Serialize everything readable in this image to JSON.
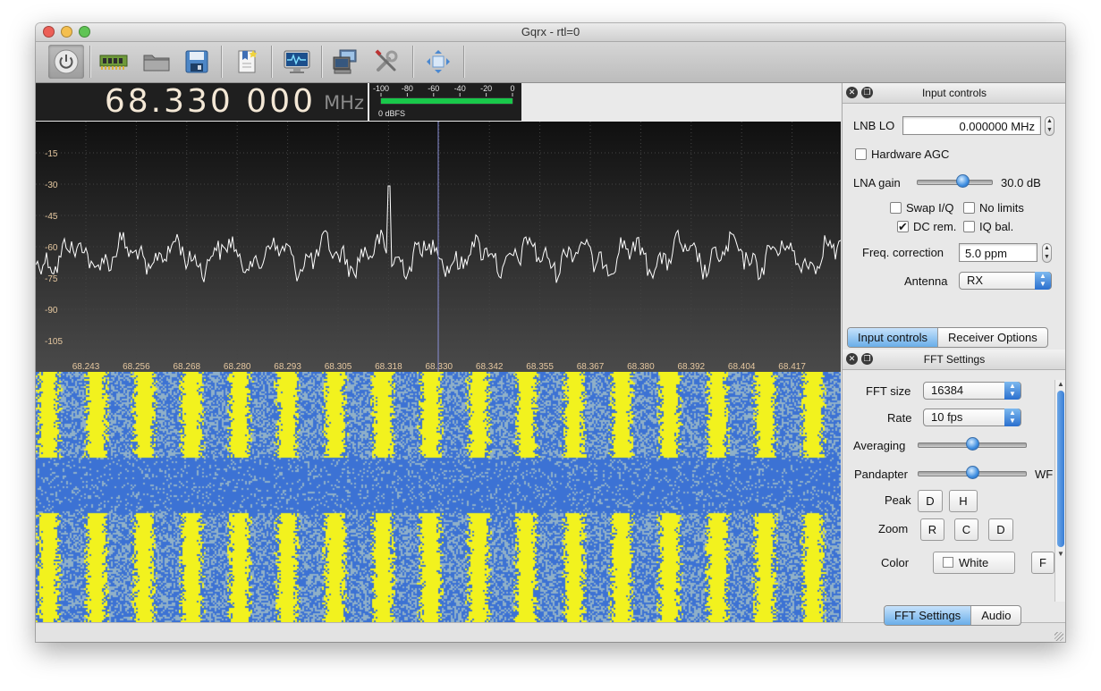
{
  "window": {
    "title": "Gqrx  - rtl=0"
  },
  "traffic_lights": {
    "close": "#ec5f57",
    "minimize": "#f4bf4f",
    "zoom": "#5fc454"
  },
  "toolbar": {
    "buttons": [
      {
        "name": "power-icon",
        "tip": "Start/Stop"
      },
      {
        "name": "device-icon"
      },
      {
        "name": "folder-icon"
      },
      {
        "name": "save-icon"
      },
      {
        "name": "bookmark-icon"
      },
      {
        "name": "monitor-icon"
      },
      {
        "name": "network-icon"
      },
      {
        "name": "tools-icon"
      },
      {
        "name": "fullscreen-icon"
      }
    ]
  },
  "frequency": {
    "value": "68.330 000",
    "unit": "MHz"
  },
  "meter": {
    "scale": [
      "-100",
      "-80",
      "-60",
      "-40",
      "-20",
      "0"
    ],
    "label": "0 dBFS",
    "level": 1.0,
    "bar_color": "#19c84a"
  },
  "plot": {
    "y_ticks": [
      "-15",
      "-30",
      "-45",
      "-60",
      "-75",
      "-90",
      "-105"
    ],
    "x_ticks": [
      "68.243",
      "68.256",
      "68.268",
      "68.280",
      "68.293",
      "68.305",
      "68.318",
      "68.330",
      "68.342",
      "68.355",
      "68.367",
      "68.380",
      "68.392",
      "68.404",
      "68.417"
    ],
    "trace_color": "#ffffff",
    "center_marker_color": "#8a8fd6"
  },
  "waterfall": {
    "colors": {
      "low": "#3c72d4",
      "mid": "#8fb0c8",
      "high": "#f2f21e"
    }
  },
  "input_controls": {
    "title": "Input controls",
    "lnb_lo_label": "LNB LO",
    "lnb_lo_value": "0.000000 MHz",
    "hardware_agc_label": "Hardware AGC",
    "hardware_agc_checked": false,
    "lna_gain_label": "LNA gain",
    "lna_gain_value": "30.0 dB",
    "lna_gain_level": 0.6,
    "swap_iq_label": "Swap I/Q",
    "no_limits_label": "No limits",
    "dc_rem_label": "DC rem.",
    "dc_rem_checked": true,
    "iq_bal_label": "IQ bal.",
    "freq_corr_label": "Freq. correction",
    "freq_corr_value": "5.0 ppm",
    "antenna_label": "Antenna",
    "antenna_value": "RX",
    "check_mark": "✔",
    "tabs": [
      "Input controls",
      "Receiver Options"
    ]
  },
  "fft_settings": {
    "title": "FFT Settings",
    "fft_size_label": "FFT size",
    "fft_size_value": "16384",
    "rate_label": "Rate",
    "rate_value": "10 fps",
    "averaging_label": "Averaging",
    "averaging_level": 0.5,
    "pandapter_label": "Pandapter",
    "pandapter_level": 0.5,
    "wf_label": "WF",
    "peak_label": "Peak",
    "peak_buttons": [
      "D",
      "H"
    ],
    "zoom_label": "Zoom",
    "zoom_buttons": [
      "R",
      "C",
      "D"
    ],
    "color_label": "Color",
    "color_value": "White",
    "f_button": "F",
    "tabs": [
      "FFT Settings",
      "Audio"
    ]
  }
}
